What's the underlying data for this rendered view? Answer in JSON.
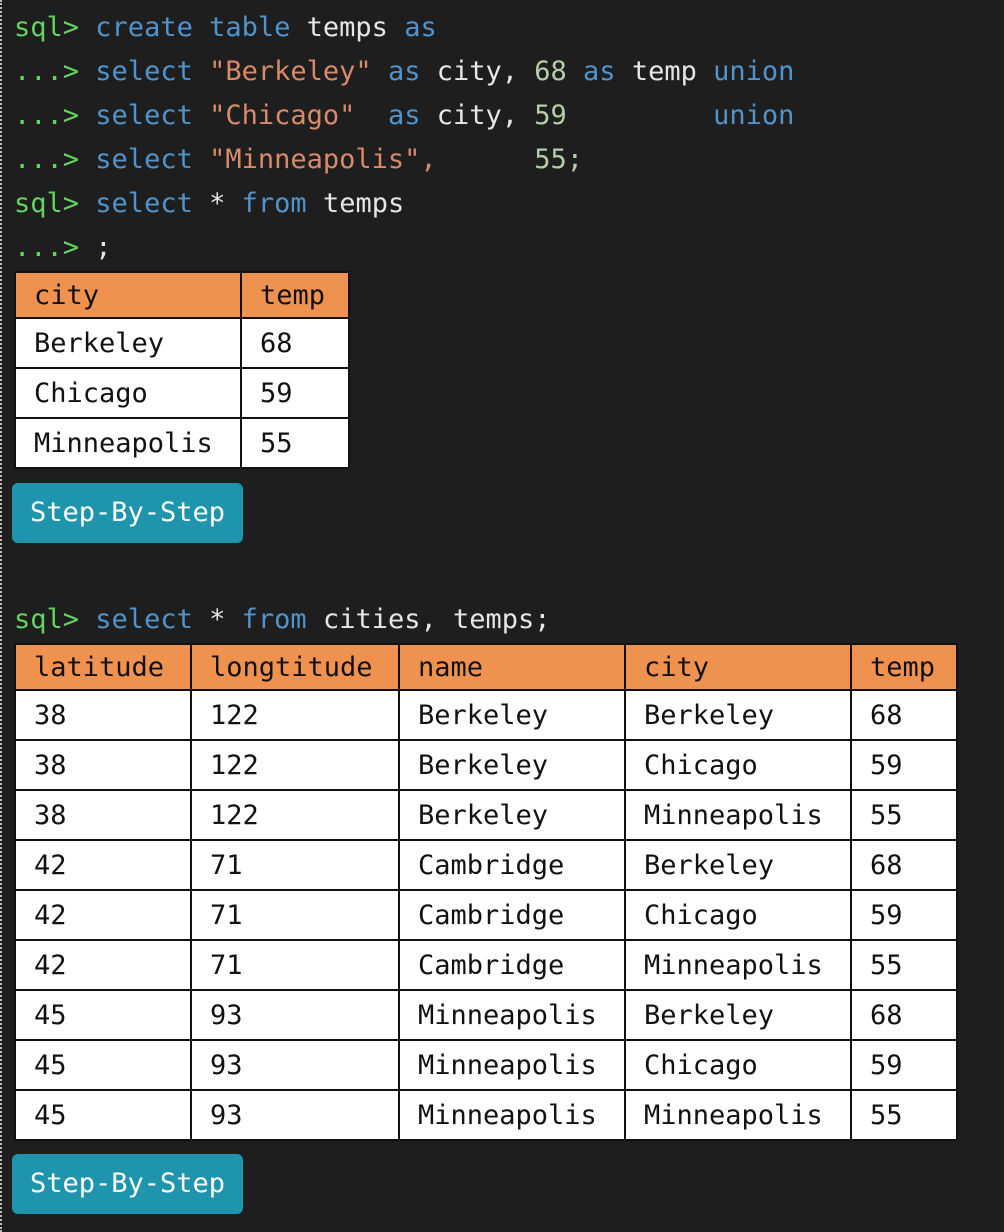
{
  "console": {
    "prompt": "sql>",
    "continuation": "...>",
    "query1": {
      "l1": {
        "kw1": "create",
        "kw2": "table",
        "name": "temps",
        "kw3": "as"
      },
      "l2": {
        "kw1": "select",
        "str": "\"Berkeley\"",
        "kw2": "as",
        "col": "city,",
        "num": "68",
        "kw3": "as",
        "col2": "temp",
        "kw4": "union"
      },
      "l3": {
        "kw1": "select",
        "str": "\"Chicago\"",
        "kw2": "as",
        "col": "city,",
        "num": "59",
        "kw4": "union"
      },
      "l4": {
        "kw1": "select",
        "str": "\"Minneapolis\",",
        "num": "55;"
      }
    },
    "query2": {
      "l1": {
        "kw1": "select",
        "star": "*",
        "kw2": "from",
        "name": "temps"
      },
      "l2": {
        "semi": ";"
      }
    },
    "query3": {
      "kw1": "select",
      "star": "*",
      "kw2": "from",
      "rest": "cities, temps;"
    }
  },
  "table1": {
    "headers": [
      "city",
      "temp"
    ],
    "rows": [
      [
        "Berkeley",
        "68"
      ],
      [
        "Chicago",
        "59"
      ],
      [
        "Minneapolis",
        "55"
      ]
    ]
  },
  "table2": {
    "headers": [
      "latitude",
      "longtitude",
      "name",
      "city",
      "temp"
    ],
    "rows": [
      [
        "38",
        "122",
        "Berkeley",
        "Berkeley",
        "68"
      ],
      [
        "38",
        "122",
        "Berkeley",
        "Chicago",
        "59"
      ],
      [
        "38",
        "122",
        "Berkeley",
        "Minneapolis",
        "55"
      ],
      [
        "42",
        "71",
        "Cambridge",
        "Berkeley",
        "68"
      ],
      [
        "42",
        "71",
        "Cambridge",
        "Chicago",
        "59"
      ],
      [
        "42",
        "71",
        "Cambridge",
        "Minneapolis",
        "55"
      ],
      [
        "45",
        "93",
        "Minneapolis",
        "Berkeley",
        "68"
      ],
      [
        "45",
        "93",
        "Minneapolis",
        "Chicago",
        "59"
      ],
      [
        "45",
        "93",
        "Minneapolis",
        "Minneapolis",
        "55"
      ]
    ]
  },
  "buttons": {
    "step1": "Step-By-Step",
    "step2": "Step-By-Step"
  },
  "colors": {
    "background": "#1e1e1e",
    "prompt": "#5fd75f",
    "keyword": "#4e94ce",
    "string": "#d98a6a",
    "number": "#b5cea8",
    "table_header": "#f0924f",
    "button": "#1e94ad"
  }
}
